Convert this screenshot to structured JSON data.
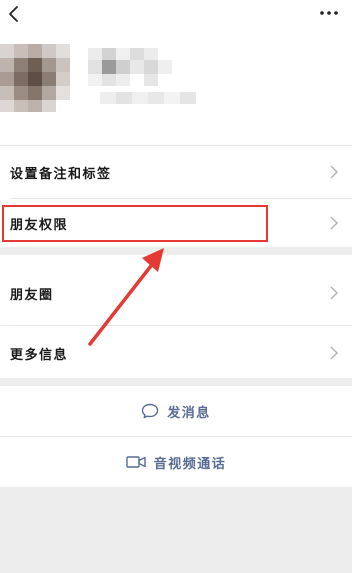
{
  "nav": {
    "back_icon": "chevron-left-icon",
    "more_icon": "more-dots-icon"
  },
  "menu": {
    "remark_tags": "设置备注和标签",
    "friend_permissions": "朋友权限",
    "moments": "朋友圈",
    "more_info": "更多信息"
  },
  "actions": {
    "send_message": "发消息",
    "video_call": "音视频通话"
  },
  "colors": {
    "highlight": "#e53935",
    "link": "#586c94"
  }
}
